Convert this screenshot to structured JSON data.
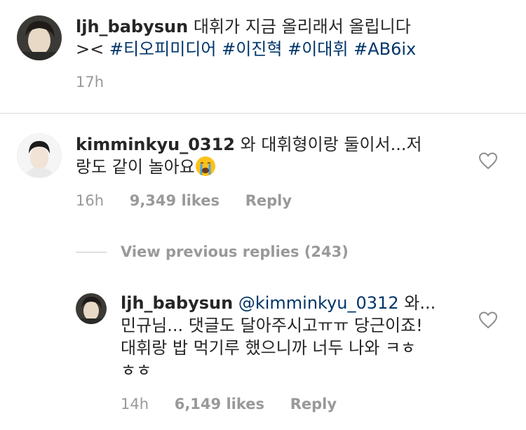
{
  "post": {
    "username": "ljh_babysun",
    "caption_text": "대휘가 지금 올리래서 올립니다",
    "caption_prefix": "><",
    "hashtags": [
      "#티오피미디어",
      "#이진혁",
      "#이대휘",
      "#AB6ix"
    ],
    "time": "17h"
  },
  "comment": {
    "username": "kimminkyu_0312",
    "text_line1": "와 대휘형이랑 둘이서...저",
    "text_line2": "랑도 같이 놀아요",
    "emoji": "crying-face-emoji",
    "time": "16h",
    "likes": "9,349 likes",
    "reply_label": "Reply"
  },
  "view_previous": {
    "label": "View previous replies (243)"
  },
  "reply": {
    "username": "ljh_babysun",
    "mention": "@kimminkyu_0312",
    "text_after_mention": "와...",
    "text_line2": "민규님... 댓글도 달아주시고ㅠㅠ 당근이죠!",
    "text_line3": "대휘랑 밥 먹기루 했으니까 너두 나와 ㅋㅎ",
    "text_line4": "ㅎㅎ",
    "time": "14h",
    "likes": "6,149 likes",
    "reply_label": "Reply"
  },
  "icons": {
    "heart": "heart-outline-icon"
  },
  "colors": {
    "text": "#262626",
    "meta": "#999999",
    "link": "#003569",
    "divider": "#dbdbdb"
  }
}
